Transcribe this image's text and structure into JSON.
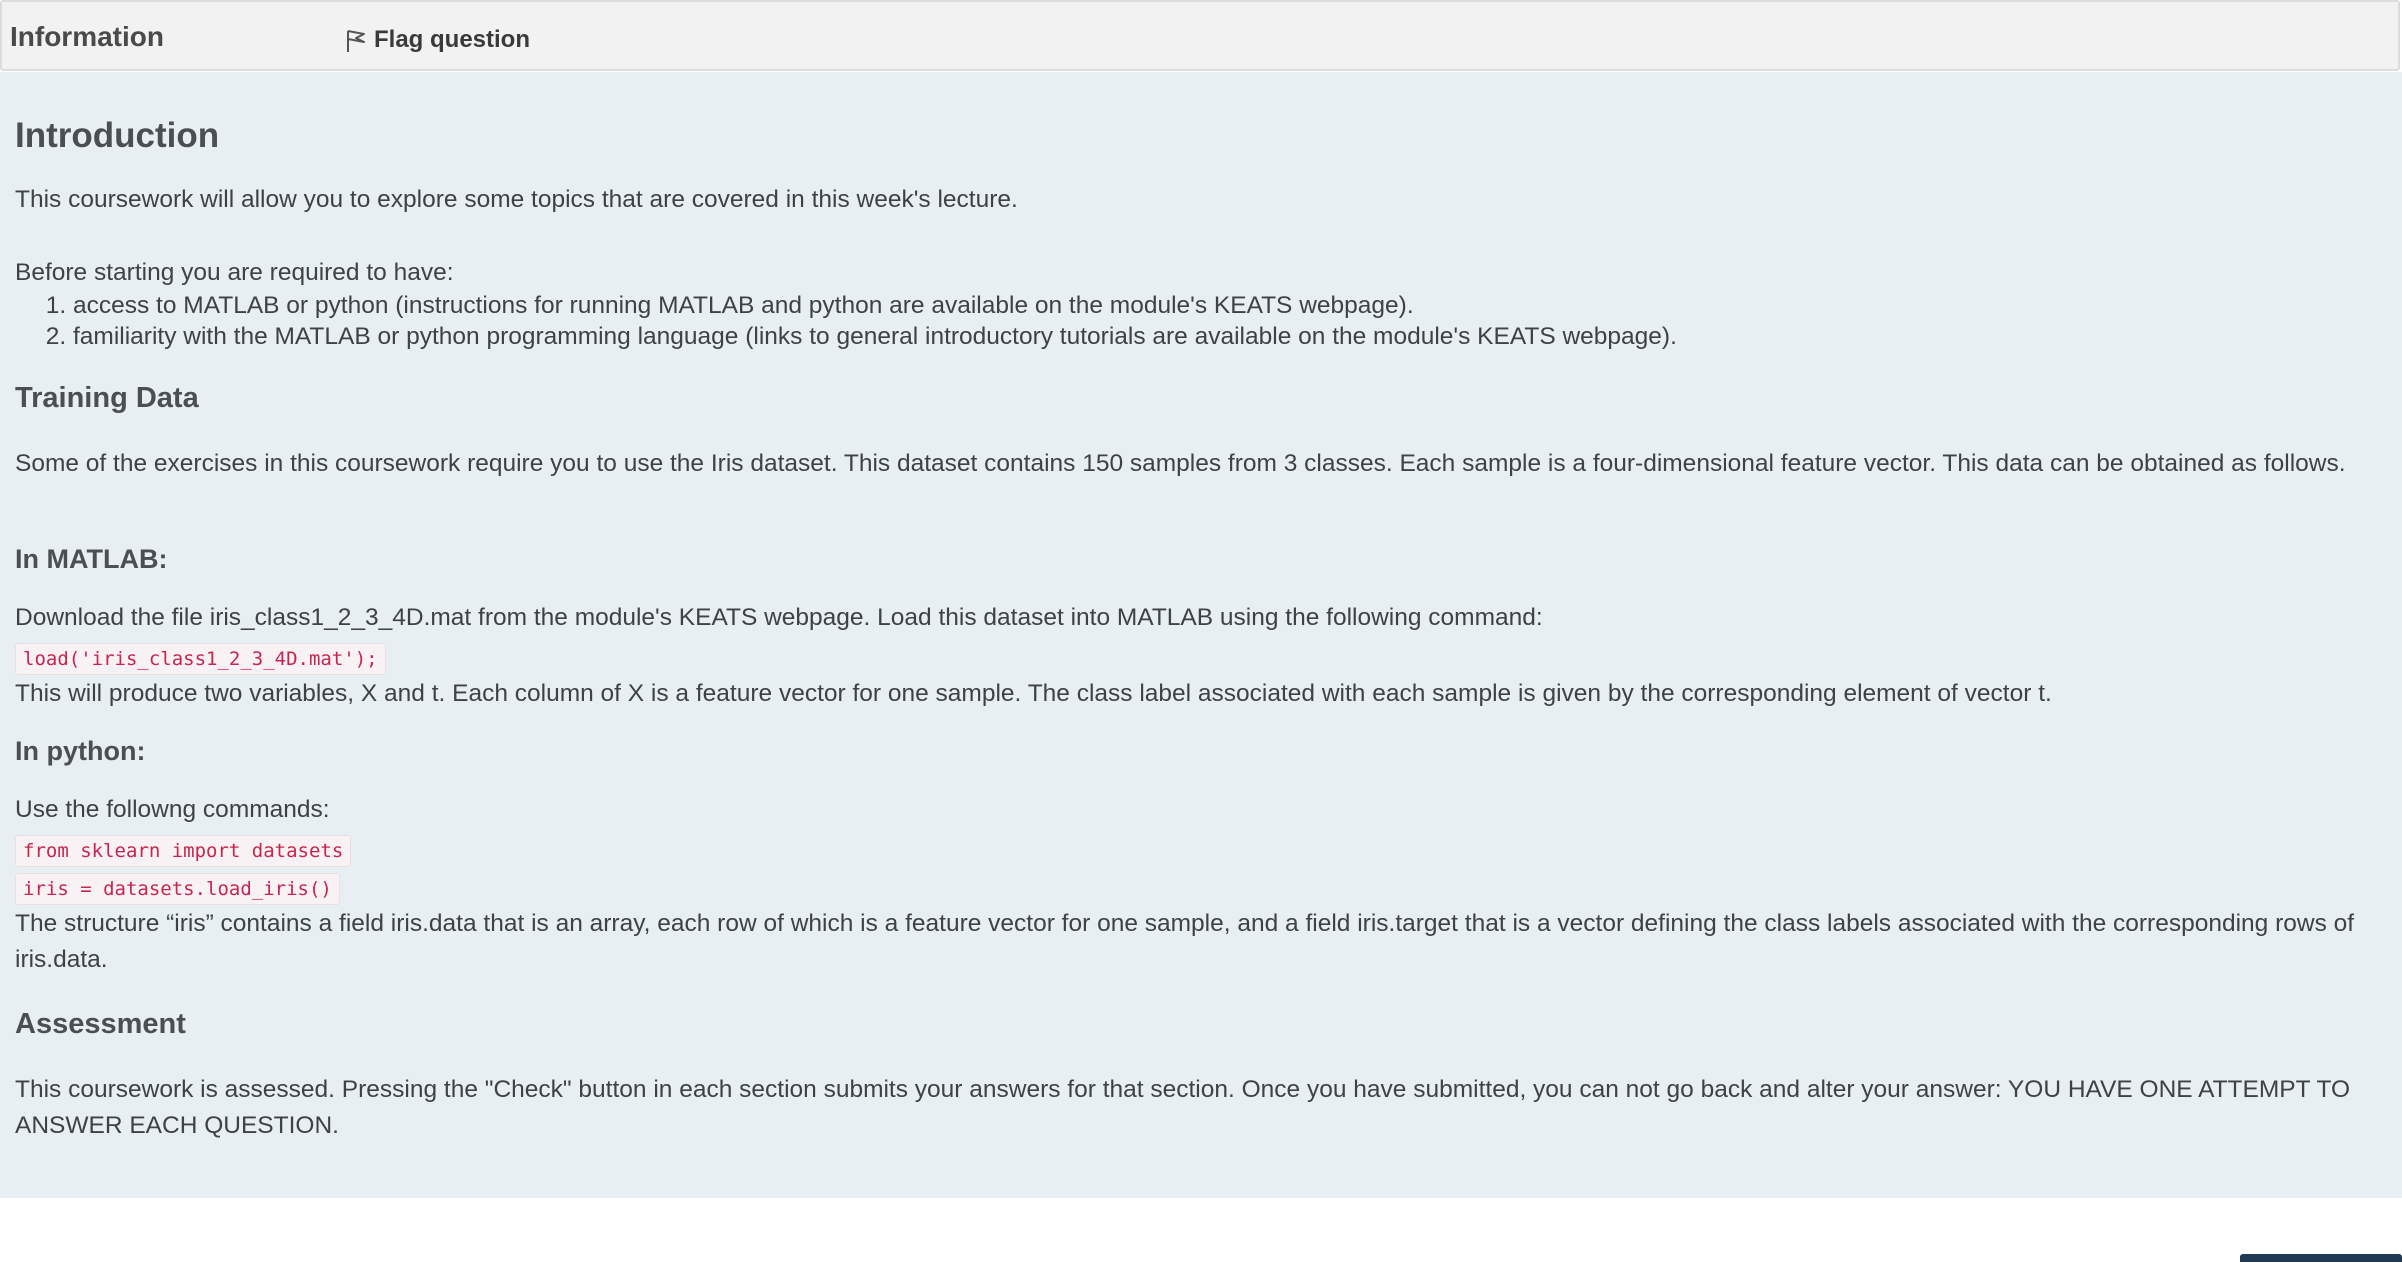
{
  "header": {
    "title": "Information",
    "flag_label": "Flag question"
  },
  "intro": {
    "heading": "Introduction",
    "text": "This coursework will allow you to explore some topics that are covered in this week's lecture.",
    "prereq_intro": "Before starting you are required to have:",
    "prereq_items": [
      "access to MATLAB or python (instructions for running MATLAB and python are available on the module's KEATS webpage).",
      "familiarity with the MATLAB or python programming language (links to general introductory tutorials are available on the module's KEATS webpage)."
    ]
  },
  "training": {
    "heading": "Training Data",
    "text": "Some of the exercises in this coursework require you to use the Iris dataset. This dataset contains 150 samples from 3 classes. Each sample is a four-dimensional feature vector. This data can be obtained as follows."
  },
  "matlab": {
    "heading": "In MATLAB:",
    "text": "Download the file iris_class1_2_3_4D.mat from the module's KEATS webpage. Load this dataset into MATLAB using the following command:",
    "code": "load('iris_class1_2_3_4D.mat');",
    "after": "This will produce two variables, X and t. Each column of X is a feature vector for one sample. The class label associated with each sample is given by the corresponding element of vector t."
  },
  "python": {
    "heading": "In python:",
    "text": "Use the followng commands:",
    "code1": "from sklearn import datasets",
    "code2": "iris = datasets.load_iris()",
    "after": "The structure “iris” contains a field iris.data that is an array, each row of which is a feature vector for one sample, and a field iris.target that is a vector defining the class labels associated with the corresponding rows of iris.data."
  },
  "assessment": {
    "heading": "Assessment",
    "text": "This coursework is assessed. Pressing the \"Check\" button in each section submits your answers for that section. Once you have submitted, you can not go back and alter your answer: YOU HAVE ONE ATTEMPT TO ANSWER EACH QUESTION."
  },
  "icons": {
    "flag": "flag-icon"
  },
  "colors": {
    "content_bg": "#e7eff3",
    "header_bg": "#f2f2f2",
    "code_text": "#c7254e",
    "button_bg": "#1f3a52"
  }
}
